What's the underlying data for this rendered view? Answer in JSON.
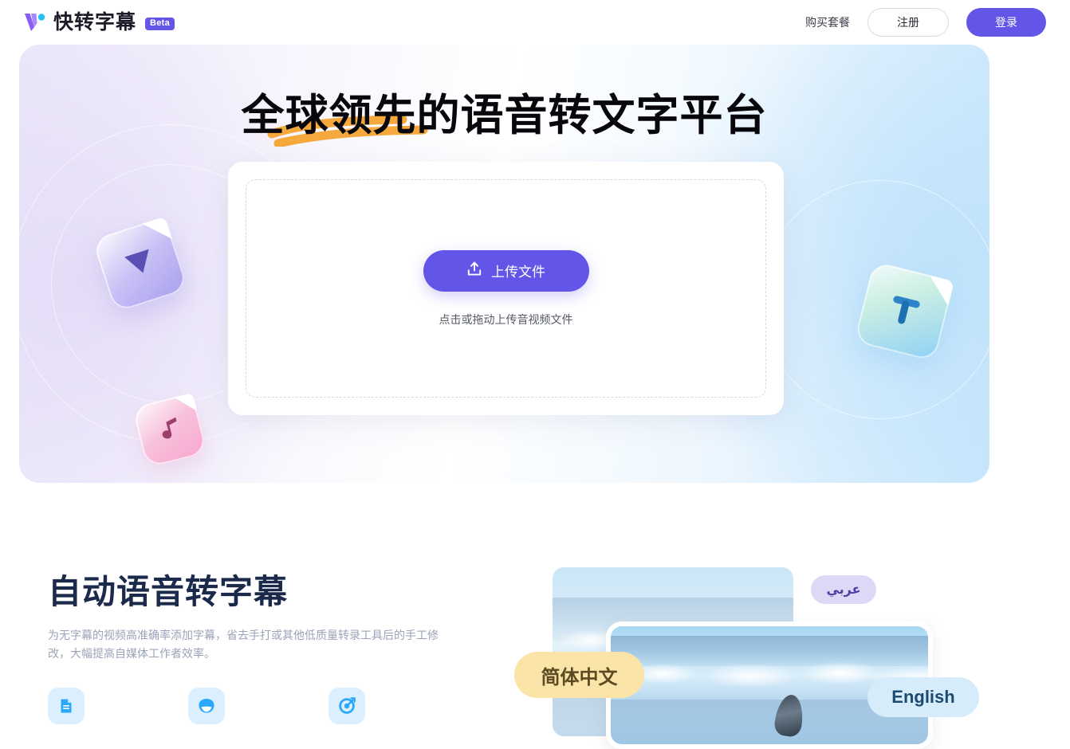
{
  "header": {
    "brand_name": "快转字幕",
    "beta_label": "Beta",
    "logo_icon": "logo-w-mark",
    "nav": {
      "pricing_label": "购买套餐",
      "register_label": "注册",
      "login_label": "登录"
    }
  },
  "hero": {
    "title": "全球领先的语音转文字平台",
    "upload": {
      "button_label": "上传文件",
      "button_icon": "upload-icon",
      "hint": "点击或拖动上传音视频文件"
    },
    "decor": {
      "video_card_icon": "play-triangle-icon",
      "audio_card_icon": "music-note-icon",
      "text_card_icon": "text-t-icon"
    }
  },
  "feature": {
    "title": "自动语音转字幕",
    "description": "为无字幕的视频高准确率添加字幕，省去手打或其他低质量转录工具后的手工修改，大幅提高自媒体工作者效率。",
    "icons": [
      {
        "name": "document-icon"
      },
      {
        "name": "speech-mouth-icon"
      },
      {
        "name": "target-accuracy-icon"
      }
    ],
    "language_pills": [
      {
        "label": "简体中文"
      },
      {
        "label": "عربي"
      },
      {
        "label": "English"
      }
    ]
  },
  "colors": {
    "brand_purple": "#6355e8",
    "accent_orange": "#f5a93c",
    "feature_icon_blue": "#2aa9fb",
    "feature_title_navy": "#1b2a4a",
    "pill_yellow": "#fbe4a8",
    "pill_lavender": "#ded8f7",
    "pill_blue": "#d7ecfb"
  }
}
